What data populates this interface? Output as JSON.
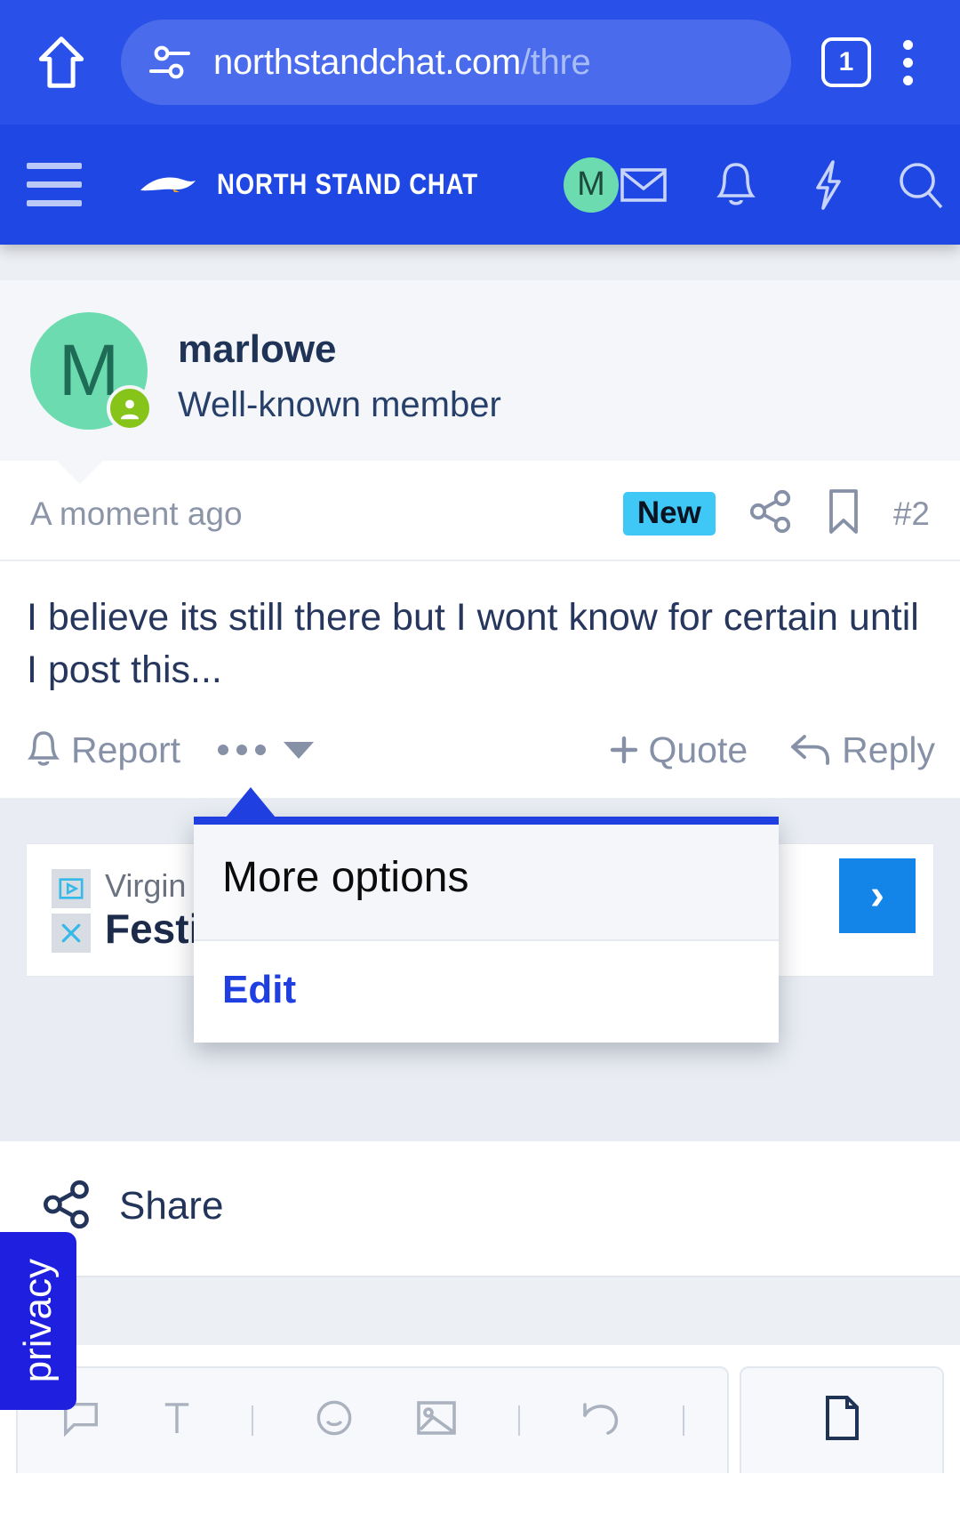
{
  "browser": {
    "home_icon": "home-icon",
    "permissions_icon": "site-settings-icon",
    "url_visible": "northstandchat.com",
    "url_dim": "/thre",
    "tab_count": "1",
    "menu_icon": "kebab-menu-icon"
  },
  "site_header": {
    "menu_icon": "hamburger-icon",
    "logo_icon": "seagull-logo-icon",
    "brand": "NORTH STAND CHAT",
    "avatar_letter": "M",
    "icons": [
      "envelope-icon",
      "bell-icon",
      "lightning-icon",
      "search-icon"
    ]
  },
  "post": {
    "avatar_letter": "M",
    "username": "marlowe",
    "user_title": "Well-known member",
    "timestamp": "A moment ago",
    "badge": "New",
    "share_icon": "share-icon",
    "bookmark_icon": "bookmark-icon",
    "post_number": "#2",
    "body": "I believe its still there but I wont know for certain until I post this...",
    "actions": {
      "report": "Report",
      "more": "more-options-toggle",
      "quote": "Quote",
      "reply": "Reply"
    }
  },
  "dropdown": {
    "header": "More options",
    "items": [
      {
        "label": "Edit"
      }
    ]
  },
  "ad": {
    "sponsor": "Virgin Win",
    "title": "Festiv",
    "cta": "›",
    "adchoices_icon": "adchoices-icon",
    "close_icon": "close-ad-icon"
  },
  "share_section": {
    "label": "Share",
    "icon": "share-icon"
  },
  "privacy_tab": {
    "label": "privacy"
  },
  "editor_toolbar": {
    "icons": [
      "quote-icon",
      "text-format-icon",
      "more-vertical-icon",
      "emoji-icon",
      "image-icon",
      "more-vertical-icon",
      "undo-icon",
      "more-vertical-icon"
    ],
    "right_icons": [
      "attachment-icon"
    ]
  },
  "colors": {
    "browser_blue": "#2950e8",
    "header_blue": "#1f47e4",
    "accent_blue": "#1f3fe0",
    "avatar_green": "#6ddbb0",
    "status_green": "#86c41a",
    "badge_cyan": "#3fc8f5",
    "text_navy": "#26365c",
    "muted": "#8690a6"
  }
}
